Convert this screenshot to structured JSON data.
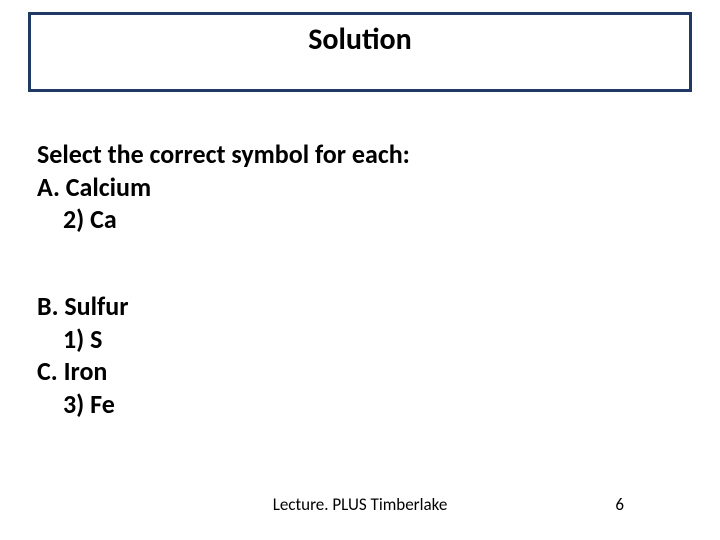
{
  "title": "Solution",
  "prompt": "Select the correct symbol for each:",
  "items": [
    {
      "label": "A. Calcium",
      "answer": "2)  Ca"
    },
    {
      "label": "B. Sulfur",
      "answer": "1)  S"
    },
    {
      "label": "C. Iron",
      "answer": "3) Fe"
    }
  ],
  "footer": {
    "center": "Lecture. PLUS  Timberlake",
    "page": "6"
  }
}
